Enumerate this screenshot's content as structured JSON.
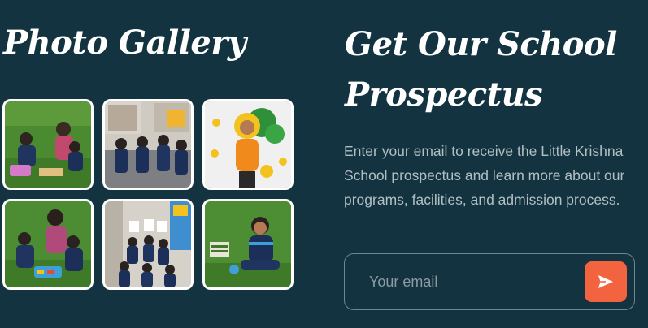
{
  "gallery": {
    "title": "Photo Gallery",
    "photos": [
      {
        "icon": "photo-children-playing-on-grass"
      },
      {
        "icon": "photo-children-in-classroom"
      },
      {
        "icon": "photo-child-in-flower-costume"
      },
      {
        "icon": "photo-children-with-teacher"
      },
      {
        "icon": "photo-children-on-stairs"
      },
      {
        "icon": "photo-child-sitting-on-grass"
      }
    ]
  },
  "prospectus": {
    "title": "Get Our School Prospectus",
    "description": "Enter your email to receive the Little Krishna School prospectus and learn more about our programs, facilities, and admission process.",
    "email_placeholder": "Your email",
    "send_icon": "send-arrow-icon"
  },
  "colors": {
    "background": "#12333f",
    "accent": "#f26440",
    "title_text": "#ffffff",
    "body_text": "#b2bfc4",
    "input_border": "#6f878f"
  }
}
